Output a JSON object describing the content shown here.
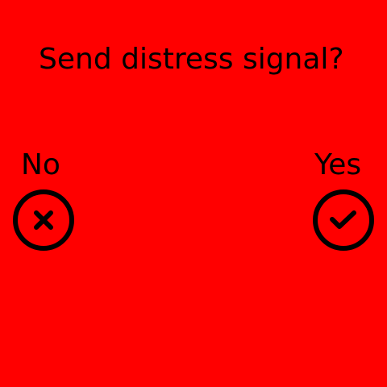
{
  "dialog": {
    "prompt": "Send distress signal?",
    "background_color": "#ff0000",
    "foreground_color": "#000000",
    "options": {
      "no": {
        "label": "No",
        "icon": "close-icon"
      },
      "yes": {
        "label": "Yes",
        "icon": "check-icon"
      }
    }
  }
}
